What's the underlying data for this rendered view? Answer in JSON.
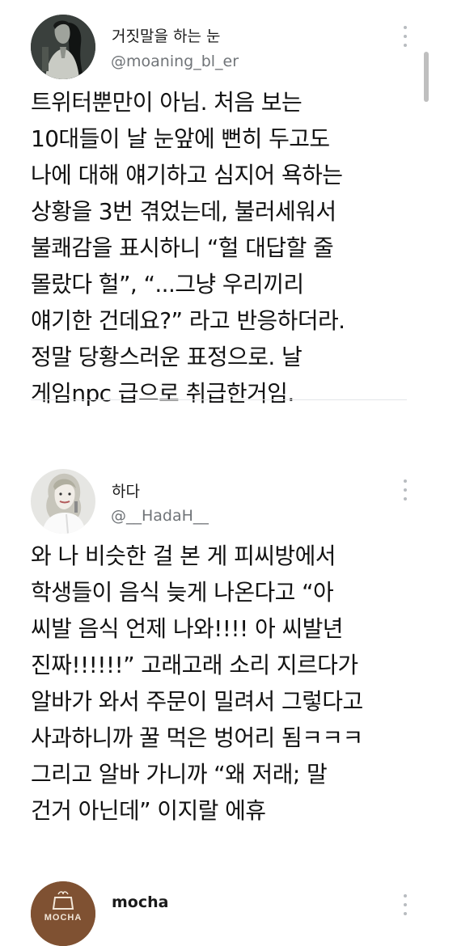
{
  "tweets": [
    {
      "display_name": "거짓말을 하는 눈",
      "handle": "@moaning_bl_er",
      "lines": [
        "트위터뿐만이 아님. 처음 보는",
        "10대들이 날 눈앞에 뻔히 두고도",
        "나에 대해 얘기하고 심지어 욕하는",
        "상황을 3번 겪었는데, 불러세워서",
        "불쾌감을 표시하니 “헐 대답할 줄",
        "몰랐다 헐”, “...그냥 우리끼리",
        "얘기한 건데요?” 라고 반응하더라.",
        "정말 당황스러운 표정으로. 날",
        "게임npc 급으로 취급한거임."
      ]
    },
    {
      "display_name": "하다",
      "handle": "@__HadaH__",
      "lines": [
        "와 나 비슷한 걸 본 게 피씨방에서",
        "학생들이 음식 늦게 나온다고 “아",
        "씨발 음식 언제 나와!!!! 아 씨발년",
        "진짜!!!!!!” 고래고래 소리 지르다가",
        "알바가 와서 주문이 밀려서 그렇다고",
        "사과하니까 꿀 먹은 벙어리 됨ㅋㅋㅋ",
        "그리고 알바 가니까 “왜 저래; 말",
        "건거 아닌데” 이지랄 에휴"
      ]
    },
    {
      "display_name": "mocha",
      "avatar_text": "MOCHA"
    }
  ]
}
